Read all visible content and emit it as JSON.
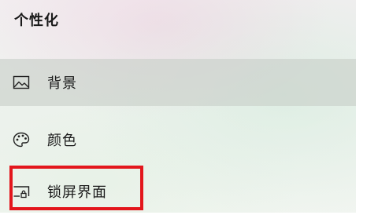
{
  "header": {
    "title": "个性化"
  },
  "sidebar": {
    "items": [
      {
        "label": "背景",
        "icon": "image-icon",
        "selected": true
      },
      {
        "label": "颜色",
        "icon": "palette-icon",
        "selected": false
      },
      {
        "label": "锁屏界面",
        "icon": "lock-screen-icon",
        "selected": false
      }
    ]
  },
  "annotation": {
    "color": "#e3161c"
  }
}
